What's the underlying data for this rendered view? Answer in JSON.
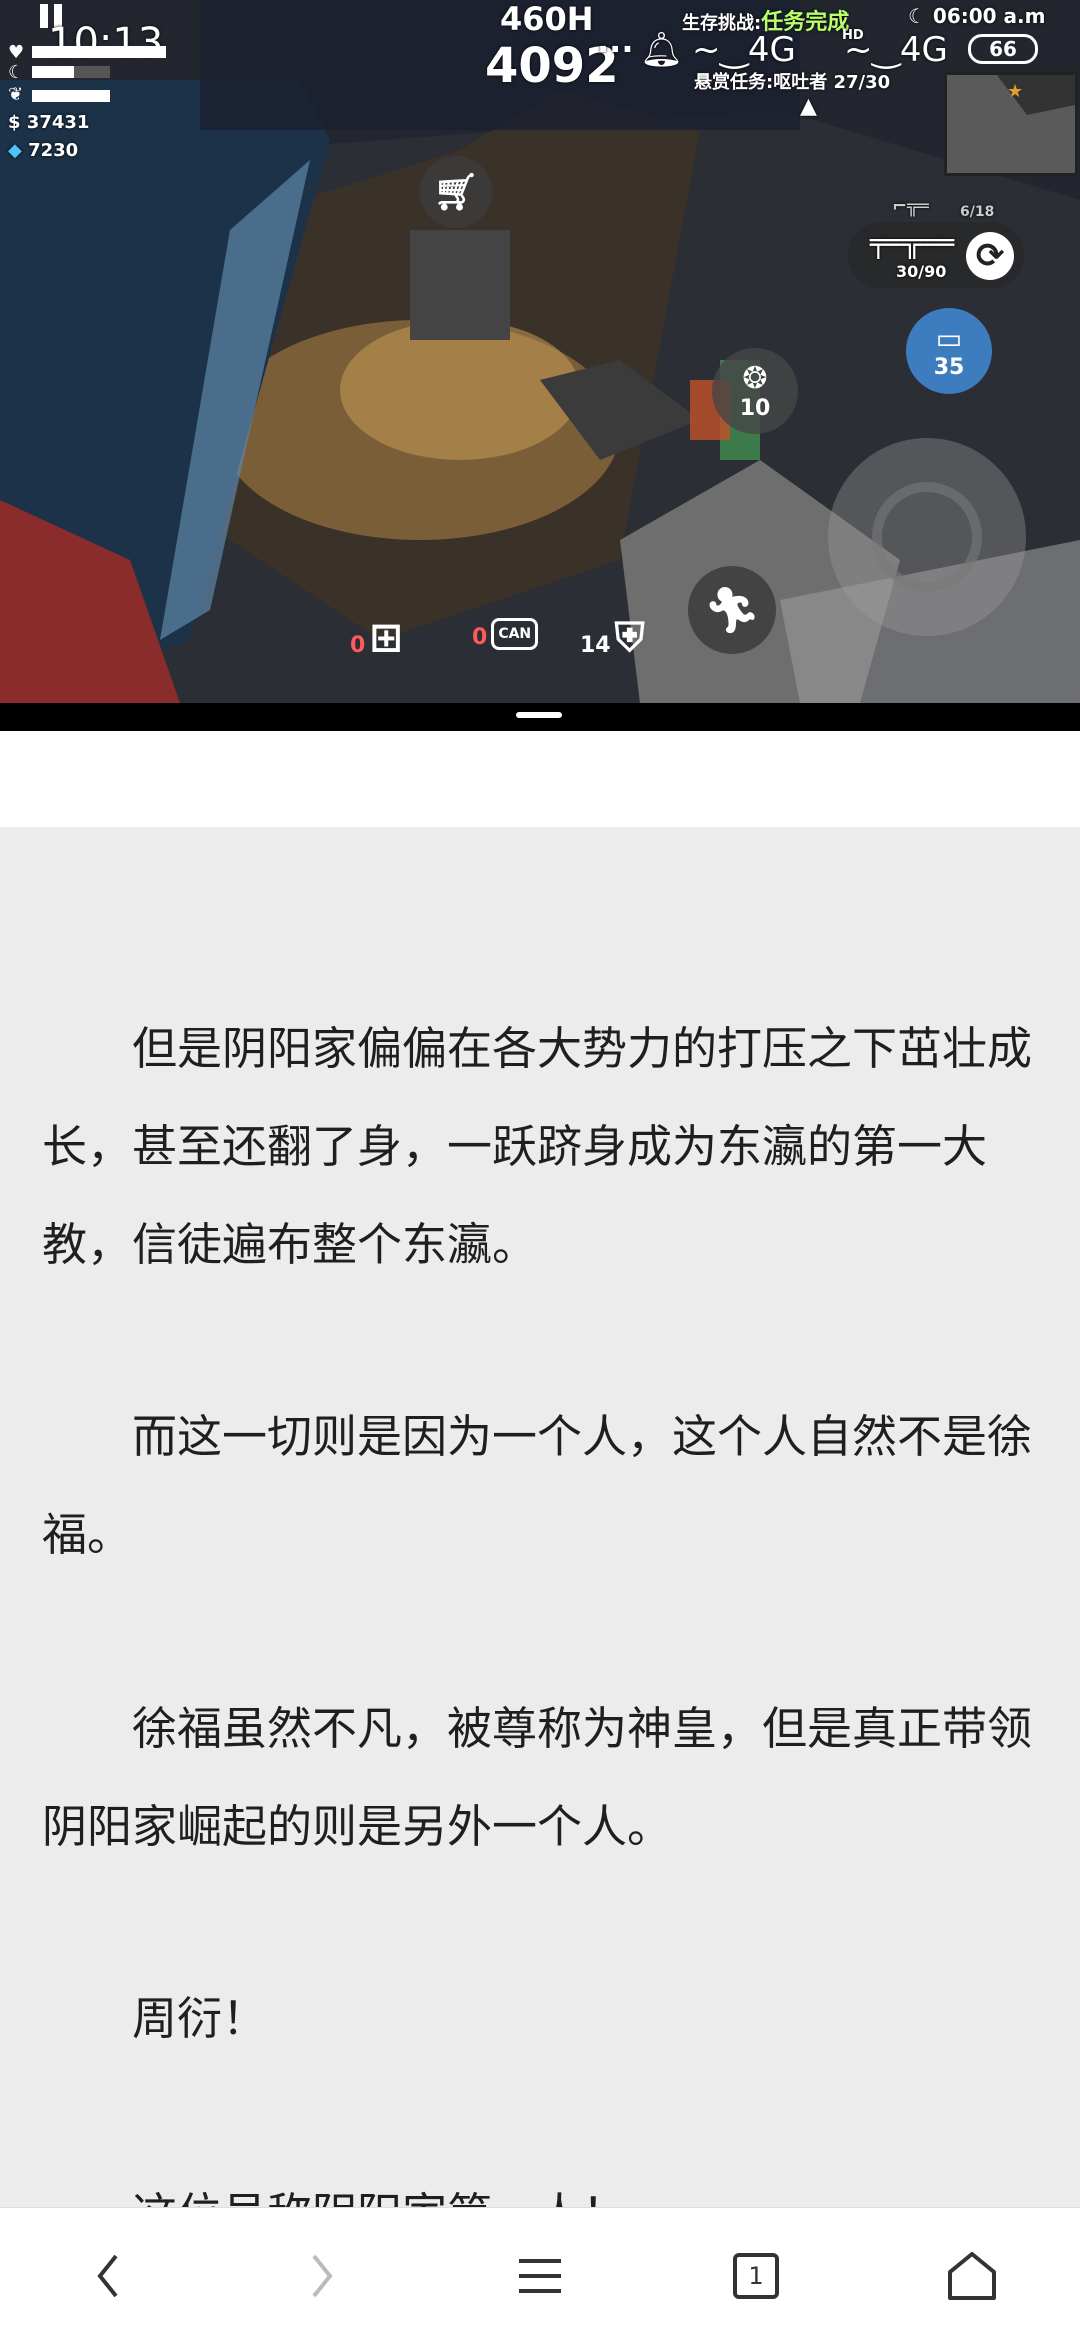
{
  "status": {
    "time": "10:13",
    "clock": "06:00 a.m",
    "network_1": "4G",
    "network_2": "4G",
    "hd": "HD",
    "battery": "66"
  },
  "game": {
    "hours": "460H",
    "score": "4092",
    "more": "···",
    "challenge_label": "生存挑战:",
    "challenge_status": "任务完成",
    "bounty": "悬赏任务:呕吐者 27/30",
    "coins": "37431",
    "gems": "7230",
    "grenade_count": "10",
    "magazine": "6/18",
    "ammo": "30/90",
    "flashlight_count": "35",
    "medkit_count": "0",
    "can_count": "0",
    "can_label": "CAN",
    "pills_count": "14",
    "health_fraction": 0.85,
    "hunger_fraction": 0.4,
    "thirst_fraction": 0.65
  },
  "article": {
    "paragraphs": [
      "但是阴阳家偏偏在各大势力的打压之下茁壮成长，甚至还翻了身，一跃跻身成为东瀛的第一大教，信徒遍布整个东瀛。",
      "而这一切则是因为一个人，这个人自然不是徐福。",
      "徐福虽然不凡，被尊称为神皇，但是真正带领阴阳家崛起的则是另外一个人。",
      "周衍！",
      "这位号称阴阳家第一人！"
    ]
  },
  "nav": {
    "tab_count": "1"
  },
  "icons": {
    "pause": "pause-icon",
    "heart": "heart-icon",
    "cart": "shopping-cart-icon",
    "grenade": "grenade-icon",
    "rifle": "rifle-icon",
    "reload": "reload-icon",
    "flashlight": "flashlight-icon",
    "run": "run-icon",
    "medkit": "medkit-icon",
    "can": "food-can-icon",
    "pills": "pill-bottle-icon",
    "back": "back-icon",
    "forward": "forward-icon",
    "menu": "menu-icon",
    "tabs": "tabs-icon",
    "home": "home-icon"
  }
}
